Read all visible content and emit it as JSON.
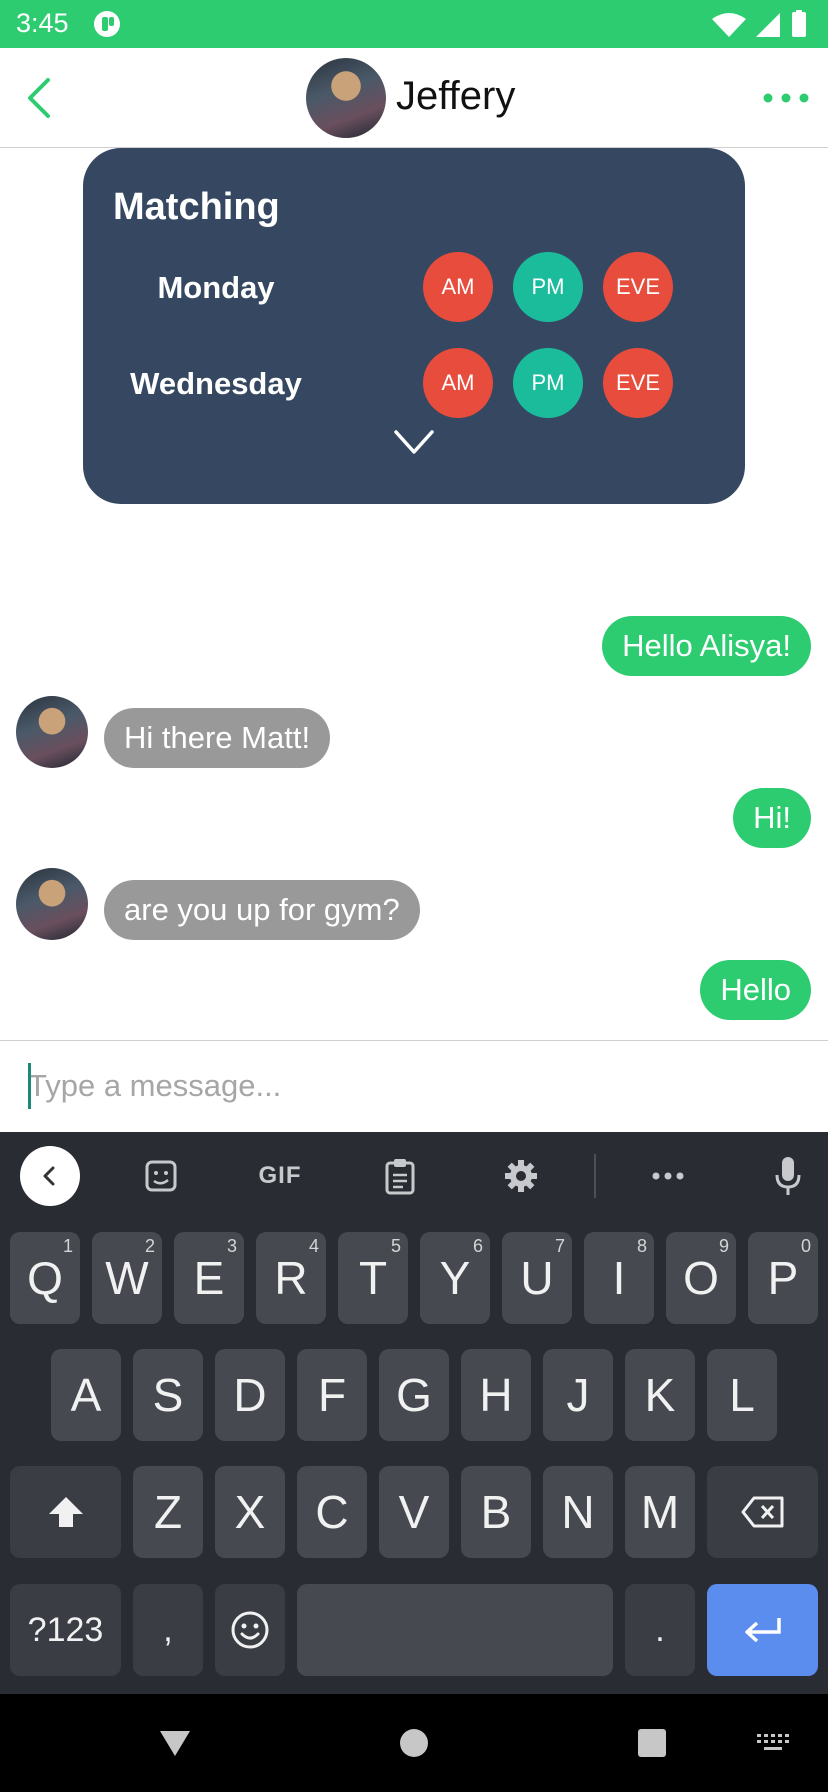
{
  "status_bar": {
    "time": "3:45",
    "icons": [
      "app-notification-icon",
      "wifi-icon",
      "cellular-signal-icon",
      "battery-icon"
    ]
  },
  "header": {
    "contact_name": "Jeffery",
    "back_icon": "chevron-left-icon",
    "more_icon": "more-horizontal-icon"
  },
  "matching": {
    "title": "Matching",
    "days": [
      {
        "day": "Monday",
        "slots": [
          {
            "label": "AM",
            "active": false
          },
          {
            "label": "PM",
            "active": true
          },
          {
            "label": "EVE",
            "active": false
          }
        ]
      },
      {
        "day": "Wednesday",
        "slots": [
          {
            "label": "AM",
            "active": false
          },
          {
            "label": "PM",
            "active": true
          },
          {
            "label": "EVE",
            "active": false
          }
        ]
      }
    ],
    "expand_icon": "chevron-down-icon"
  },
  "messages": [
    {
      "direction": "out",
      "text": "Hello Alisya!"
    },
    {
      "direction": "in",
      "text": "Hi there Matt!"
    },
    {
      "direction": "out",
      "text": "Hi!"
    },
    {
      "direction": "in",
      "text": "are you up for gym?"
    },
    {
      "direction": "out",
      "text": "Hello"
    }
  ],
  "composer": {
    "placeholder": "Type a message...",
    "value": ""
  },
  "keyboard": {
    "toolbar": {
      "gif_label": "GIF"
    },
    "row1": [
      {
        "k": "Q",
        "h": "1"
      },
      {
        "k": "W",
        "h": "2"
      },
      {
        "k": "E",
        "h": "3"
      },
      {
        "k": "R",
        "h": "4"
      },
      {
        "k": "T",
        "h": "5"
      },
      {
        "k": "Y",
        "h": "6"
      },
      {
        "k": "U",
        "h": "7"
      },
      {
        "k": "I",
        "h": "8"
      },
      {
        "k": "O",
        "h": "9"
      },
      {
        "k": "P",
        "h": "0"
      }
    ],
    "row2": [
      "A",
      "S",
      "D",
      "F",
      "G",
      "H",
      "J",
      "K",
      "L"
    ],
    "row3": [
      "Z",
      "X",
      "C",
      "V",
      "B",
      "N",
      "M"
    ],
    "symbols_label": "?123",
    "comma_label": ",",
    "period_label": "."
  },
  "colors": {
    "brand_green": "#2ecc71",
    "card_bg": "#364861",
    "slot_off": "#e74c3c",
    "slot_on": "#1abc9c",
    "incoming_bubble": "#999999",
    "enter_key": "#5b8def"
  }
}
